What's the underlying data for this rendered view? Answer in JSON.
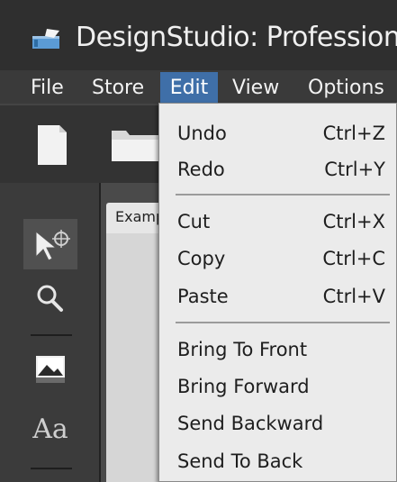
{
  "window": {
    "title": "DesignStudio: ProfessionalDemo"
  },
  "menubar": {
    "items": [
      {
        "label": "File"
      },
      {
        "label": "Store"
      },
      {
        "label": "Edit",
        "active": true
      },
      {
        "label": "View"
      },
      {
        "label": "Options"
      }
    ]
  },
  "toolbar": {
    "icons": [
      "new-document-icon",
      "open-folder-icon"
    ]
  },
  "tools": {
    "items": [
      {
        "icon": "select-pointer-icon",
        "selected": true
      },
      {
        "icon": "zoom-icon"
      },
      {
        "icon": "image-icon"
      },
      {
        "icon": "text-icon",
        "glyph": "Aa"
      }
    ]
  },
  "document": {
    "tab_label": "Example"
  },
  "edit_menu": {
    "groups": [
      [
        {
          "label": "Undo",
          "shortcut": "Ctrl+Z"
        },
        {
          "label": "Redo",
          "shortcut": "Ctrl+Y"
        }
      ],
      [
        {
          "label": "Cut",
          "shortcut": "Ctrl+X"
        },
        {
          "label": "Copy",
          "shortcut": "Ctrl+C"
        },
        {
          "label": "Paste",
          "shortcut": "Ctrl+V"
        }
      ],
      [
        {
          "label": "Bring To Front",
          "shortcut": ""
        },
        {
          "label": "Bring Forward",
          "shortcut": ""
        },
        {
          "label": "Send Backward",
          "shortcut": ""
        },
        {
          "label": "Send To Back",
          "shortcut": ""
        }
      ]
    ]
  },
  "colors": {
    "accent": "#3f6fa8",
    "menu_bg": "#ebebeb",
    "chrome_dark": "#2f2f2f"
  }
}
